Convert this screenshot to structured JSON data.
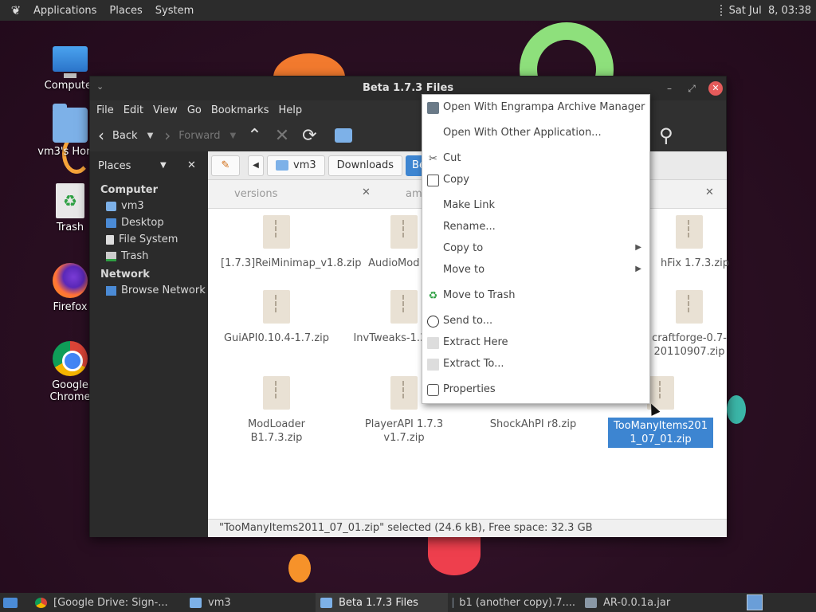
{
  "top_panel": {
    "menus": [
      "Applications",
      "Places",
      "System"
    ],
    "clock": "Sat Jul  8, 03:38"
  },
  "desktop": {
    "icons": [
      {
        "label": "Computer",
        "icon": "computer-icon"
      },
      {
        "label": "vm3's Home",
        "icon": "home-folder-icon"
      },
      {
        "label": "Trash",
        "icon": "trash-icon"
      },
      {
        "label": "Firefox",
        "icon": "firefox-icon"
      },
      {
        "label": "Google Chrome",
        "icon": "chrome-icon"
      }
    ]
  },
  "window": {
    "title": "Beta 1.7.3 Files",
    "menubar": [
      "File",
      "Edit",
      "View",
      "Go",
      "Bookmarks",
      "Help"
    ],
    "toolbar": {
      "back": "Back",
      "forward": "Forward"
    },
    "sidebar": {
      "header": "Places",
      "computer_label": "Computer",
      "computer_items": [
        "vm3",
        "Desktop",
        "File System",
        "Trash"
      ],
      "network_label": "Network",
      "network_items": [
        "Browse Network"
      ]
    },
    "pathbar": {
      "segments": [
        "vm3",
        "Downloads",
        "Beta 1.7.3 Files"
      ]
    },
    "tabs": [
      "versions",
      "amr"
    ],
    "files": [
      "[1.7.3]ReiMinimap_v1.8.zip",
      "AudioMod B1.",
      "",
      "hFix 1.7.3.zip",
      "GuiAPI0.10.4-1.7.zip",
      "InvTweaks-1.31 .zip",
      "",
      "craftforge-0.7-20110907.zip",
      "ModLoader B1.7.3.zip",
      "PlayerAPI 1.7.3 v1.7.zip",
      "ShockAhPI r8.zip",
      "TooManyItems2011_07_01.zip"
    ],
    "status": "\"TooManyItems2011_07_01.zip\" selected (24.6 kB), Free space: 32.3 GB"
  },
  "context_menu": {
    "items": [
      {
        "label": "Open With Engrampa Archive Manager",
        "icon": "archive-manager-icon"
      },
      {
        "label": "Open With Other Application...",
        "icon": ""
      },
      {
        "label": "Cut",
        "icon": "cut-icon"
      },
      {
        "label": "Copy",
        "icon": "copy-icon"
      },
      {
        "label": "Make Link",
        "icon": ""
      },
      {
        "label": "Rename...",
        "icon": ""
      },
      {
        "label": "Copy to",
        "icon": "",
        "submenu": true
      },
      {
        "label": "Move to",
        "icon": "",
        "submenu": true
      },
      {
        "label": "Move to Trash",
        "icon": "trash-icon"
      },
      {
        "label": "Send to...",
        "icon": "send-icon"
      },
      {
        "label": "Extract Here",
        "icon": "extract-icon"
      },
      {
        "label": "Extract To...",
        "icon": "extract-icon"
      },
      {
        "label": "Properties",
        "icon": "properties-icon"
      }
    ]
  },
  "taskbar": {
    "tasks": [
      {
        "label": "[Google Drive: Sign-...",
        "icon": "chrome-icon"
      },
      {
        "label": "vm3",
        "icon": "folder-icon"
      },
      {
        "label": "Beta 1.7.3 Files",
        "icon": "folder-icon",
        "active": true
      },
      {
        "label": "b1 (another copy).7....",
        "icon": "archive-icon"
      },
      {
        "label": "AR-0.0.1a.jar",
        "icon": "archive-icon"
      }
    ]
  },
  "colors": {
    "selection": "#3d85d1",
    "panel": "#2c2c2c",
    "window_dark": "#303030",
    "close_button": "#e55b5b"
  }
}
